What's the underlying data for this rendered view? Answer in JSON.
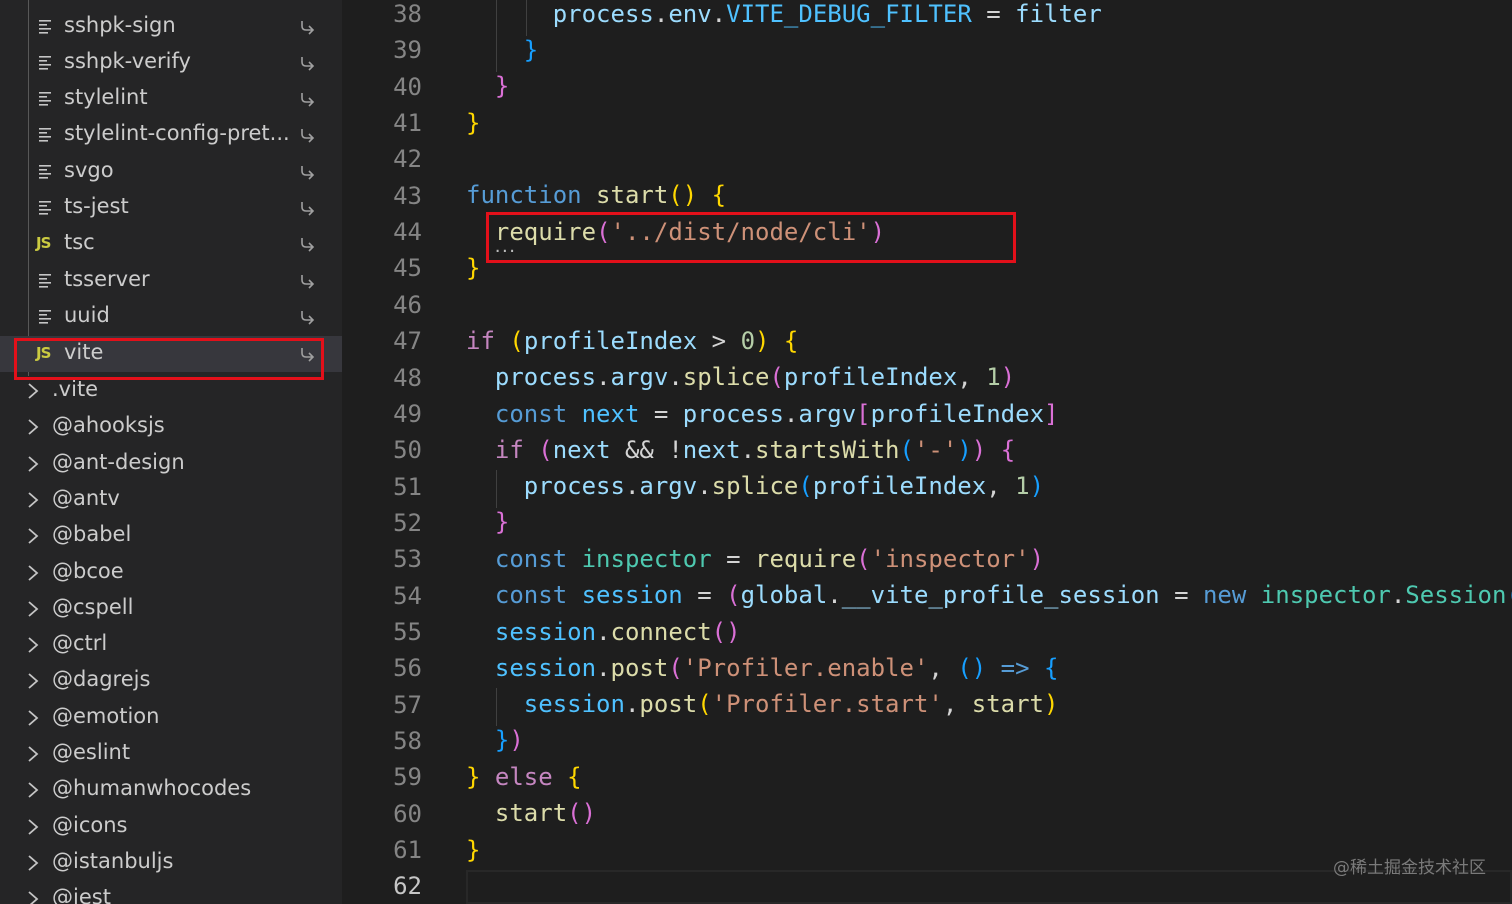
{
  "sidebar": {
    "files": [
      {
        "label": "sshpk-sign",
        "icon": "file-lines-icon"
      },
      {
        "label": "sshpk-verify",
        "icon": "file-lines-icon"
      },
      {
        "label": "stylelint",
        "icon": "file-lines-icon"
      },
      {
        "label": "stylelint-config-pret...",
        "icon": "file-lines-icon"
      },
      {
        "label": "svgo",
        "icon": "file-lines-icon"
      },
      {
        "label": "ts-jest",
        "icon": "file-lines-icon"
      },
      {
        "label": "tsc",
        "icon": "js-file-icon"
      },
      {
        "label": "tsserver",
        "icon": "file-lines-icon"
      },
      {
        "label": "uuid",
        "icon": "file-lines-icon"
      },
      {
        "label": "vite",
        "icon": "js-file-icon"
      }
    ],
    "js_badge": "JS",
    "folders": [
      ".vite",
      "@ahooksjs",
      "@ant-design",
      "@antv",
      "@babel",
      "@bcoe",
      "@cspell",
      "@ctrl",
      "@dagrejs",
      "@emotion",
      "@eslint",
      "@humanwhocodes",
      "@icons",
      "@istanbuljs",
      "@jest"
    ]
  },
  "editor": {
    "line_numbers": [
      "38",
      "39",
      "40",
      "41",
      "42",
      "43",
      "44",
      "45",
      "46",
      "47",
      "48",
      "49",
      "50",
      "51",
      "52",
      "53",
      "54",
      "55",
      "56",
      "57",
      "58",
      "59",
      "60",
      "61",
      "62"
    ],
    "active_line": "62"
  },
  "colors": {
    "highlight_box": "#e3101a",
    "background": "#1e1e1e",
    "sidebar": "#252526"
  },
  "watermark": "@稀土掘金技术社区"
}
